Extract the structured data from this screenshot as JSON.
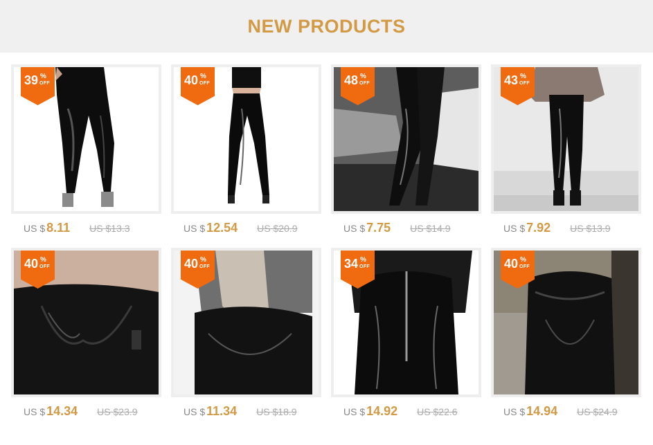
{
  "header": {
    "title": "NEW PRODUCTS"
  },
  "colors": {
    "accent": "#d39a45",
    "badge": "#f06a10",
    "header_bg": "#f0f0f0"
  },
  "badge_percent": "%",
  "badge_off": "OFF",
  "products": [
    {
      "discount": "39",
      "currency": "US $",
      "price": "8.11",
      "original": "US $13.3"
    },
    {
      "discount": "40",
      "currency": "US $",
      "price": "12.54",
      "original": "US $20.9"
    },
    {
      "discount": "48",
      "currency": "US $",
      "price": "7.75",
      "original": "US $14.9"
    },
    {
      "discount": "43",
      "currency": "US $",
      "price": "7.92",
      "original": "US $13.9"
    },
    {
      "discount": "40",
      "currency": "US $",
      "price": "14.34",
      "original": "US $23.9"
    },
    {
      "discount": "40",
      "currency": "US $",
      "price": "11.34",
      "original": "US $18.9"
    },
    {
      "discount": "34",
      "currency": "US $",
      "price": "14.92",
      "original": "US $22.6"
    },
    {
      "discount": "40",
      "currency": "US $",
      "price": "14.94",
      "original": "US $24.9"
    }
  ]
}
